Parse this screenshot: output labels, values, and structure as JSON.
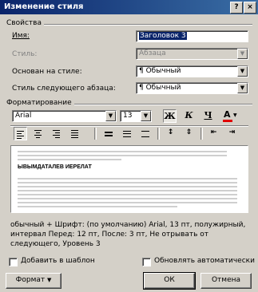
{
  "window": {
    "title": "Изменение стиля"
  },
  "titlebar_buttons": {
    "help": "?",
    "close": "×"
  },
  "properties": {
    "group_label": "Свойства",
    "name_label": "Имя:",
    "name_value": "Заголовок 3",
    "style_label": "Стиль:",
    "style_value": "Абзаца",
    "based_on_label": "Основан на стиле:",
    "based_on_value": "¶ Обычный",
    "next_style_label": "Стиль следующего абзаца:",
    "next_style_value": "¶ Обычный"
  },
  "formatting": {
    "group_label": "Форматирование",
    "font_value": "Arial",
    "size_value": "13",
    "bold": "Ж",
    "italic": "К",
    "underline": "Ч",
    "font_color_letter": "A",
    "font_color": "#e00000"
  },
  "preview": {
    "sample_text": "ЫВЫМДАТАЛЕВ ИЕРЕЛАТ"
  },
  "description": "обычный + Шрифт: (по умолчанию) Arial, 13 пт, полужирный, интервал Перед: 12 пт, После: 3 пт, Не отрывать от следующего, Уровень 3",
  "options": {
    "add_to_template": "Добавить в шаблон",
    "auto_update": "Обновлять автоматически"
  },
  "buttons": {
    "format": "Формат",
    "ok": "ОК",
    "cancel": "Отмена"
  }
}
